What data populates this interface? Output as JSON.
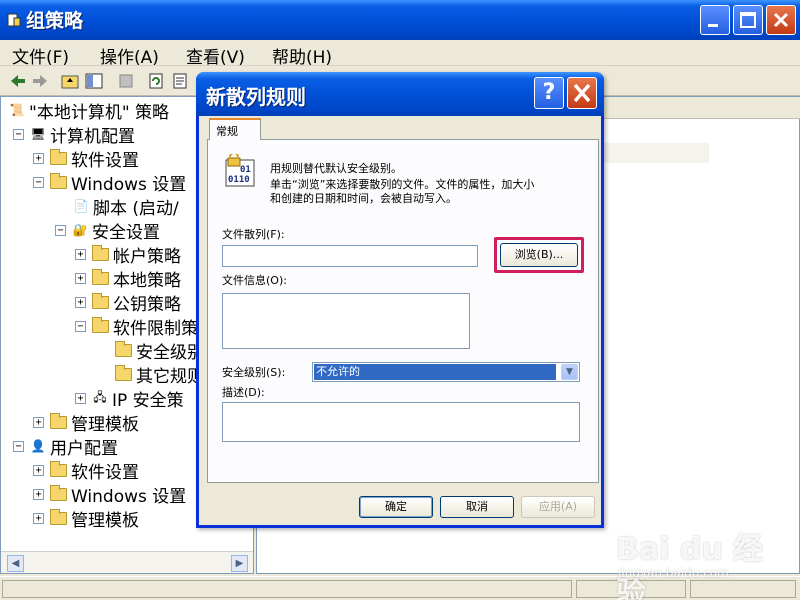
{
  "window": {
    "title": "组策略",
    "menu": [
      "文件(F)",
      "操作(A)",
      "查看(V)",
      "帮助(H)"
    ]
  },
  "tree": {
    "items": [
      {
        "label": "\"本地计算机\" 策略",
        "level": 0
      },
      {
        "label": "计算机配置",
        "level": 1
      },
      {
        "label": "软件设置",
        "level": 2
      },
      {
        "label": "Windows 设置",
        "level": 2
      },
      {
        "label": "脚本 (启动/",
        "level": 3
      },
      {
        "label": "安全设置",
        "level": 3
      },
      {
        "label": "帐户策略",
        "level": 4
      },
      {
        "label": "本地策略",
        "level": 4
      },
      {
        "label": "公钥策略",
        "level": 4
      },
      {
        "label": "软件限制策",
        "level": 4
      },
      {
        "label": "安全级别",
        "level": 5
      },
      {
        "label": "其它规则",
        "level": 5
      },
      {
        "label": "IP 安全策",
        "level": 4
      },
      {
        "label": "管理模板",
        "level": 2
      },
      {
        "label": "用户配置",
        "level": 1
      },
      {
        "label": "软件设置",
        "level": 2
      },
      {
        "label": "Windows 设置",
        "level": 2
      },
      {
        "label": "管理模板",
        "level": 2
      }
    ]
  },
  "dialog": {
    "title": "新散列规则",
    "help_label": "?",
    "tab_label": "常规",
    "description_line1": "用规则替代默认安全级别。",
    "description_line2": "单击“浏览”来选择要散列的文件。文件的属性，加大小",
    "description_line3": "和创建的日期和时间，会被自动写入。",
    "hash_label": "文件散列(F):",
    "hash_value": "",
    "browse_button": "浏览(B)...",
    "info_label": "文件信息(O):",
    "info_value": "",
    "security_level_label": "安全级别(S):",
    "security_level_value": "不允许的",
    "description_label": "描述(D):",
    "description_value": "",
    "ok_button": "确定",
    "cancel_button": "取消",
    "apply_button": "应用(A)"
  },
  "watermark": {
    "brand": "Bai du 经验",
    "url": "jingyan.baidu.com"
  }
}
